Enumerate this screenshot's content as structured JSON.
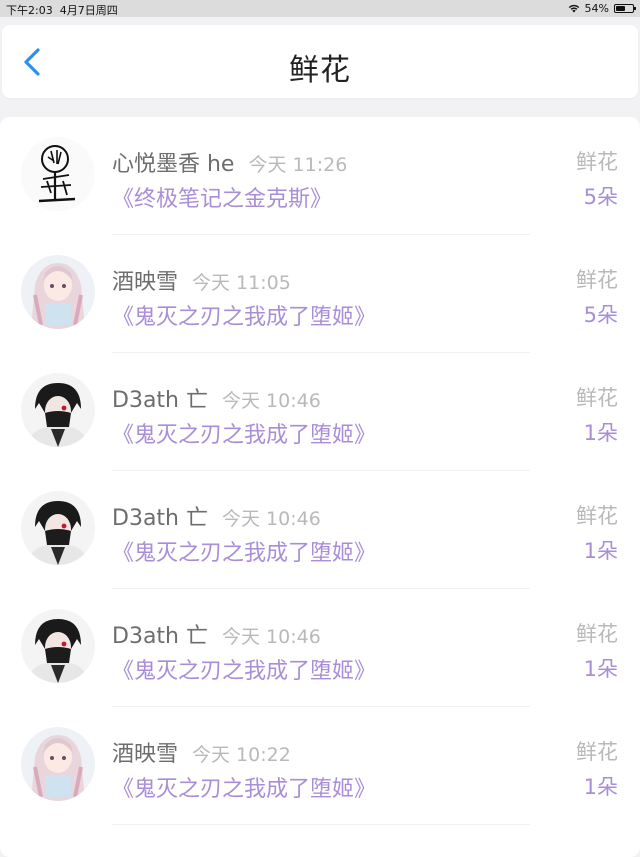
{
  "status_bar": {
    "time": "下午2:03",
    "date": "4月7日周四",
    "battery": "54%",
    "battery_level": 0.54
  },
  "nav": {
    "title": "鲜花",
    "back_icon": "chevron-left-icon",
    "accent": "#2f8ff0"
  },
  "colors": {
    "book_title": "#a98ed7",
    "muted": "#b9b9b9",
    "username": "#6d6d6d"
  },
  "gifts": [
    {
      "user": "心悦墨香 he",
      "time": "今天 11:26",
      "book": "《终极笔记之金克斯》",
      "type": "鲜花",
      "count": "5朵",
      "avatar": "doodle"
    },
    {
      "user": "酒映雪",
      "time": "今天 11:05",
      "book": "《鬼灭之刃之我成了堕姬》",
      "type": "鲜花",
      "count": "5朵",
      "avatar": "anime-girl"
    },
    {
      "user": "D3ath 亡",
      "time": "今天 10:46",
      "book": "《鬼灭之刃之我成了堕姬》",
      "type": "鲜花",
      "count": "1朵",
      "avatar": "masked-boy"
    },
    {
      "user": "D3ath 亡",
      "time": "今天 10:46",
      "book": "《鬼灭之刃之我成了堕姬》",
      "type": "鲜花",
      "count": "1朵",
      "avatar": "masked-boy"
    },
    {
      "user": "D3ath 亡",
      "time": "今天 10:46",
      "book": "《鬼灭之刃之我成了堕姬》",
      "type": "鲜花",
      "count": "1朵",
      "avatar": "masked-boy"
    },
    {
      "user": "酒映雪",
      "time": "今天 10:22",
      "book": "《鬼灭之刃之我成了堕姬》",
      "type": "鲜花",
      "count": "1朵",
      "avatar": "anime-girl"
    }
  ]
}
